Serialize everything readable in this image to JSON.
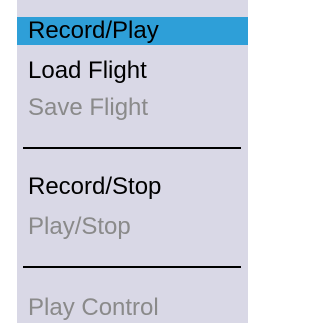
{
  "menu": {
    "header_label": "Record/Play",
    "items": [
      {
        "label": "Load Flight",
        "enabled": true
      },
      {
        "label": "Save Flight",
        "enabled": false
      },
      {
        "label": "Record/Stop",
        "enabled": true
      },
      {
        "label": "Play/Stop",
        "enabled": false
      },
      {
        "label": "Play Control",
        "enabled": false
      }
    ]
  },
  "colors": {
    "menu_background": "#d9d8e6",
    "header_background": "#2e9fd8",
    "enabled_text": "#000000",
    "disabled_text": "#8a8a8a"
  }
}
